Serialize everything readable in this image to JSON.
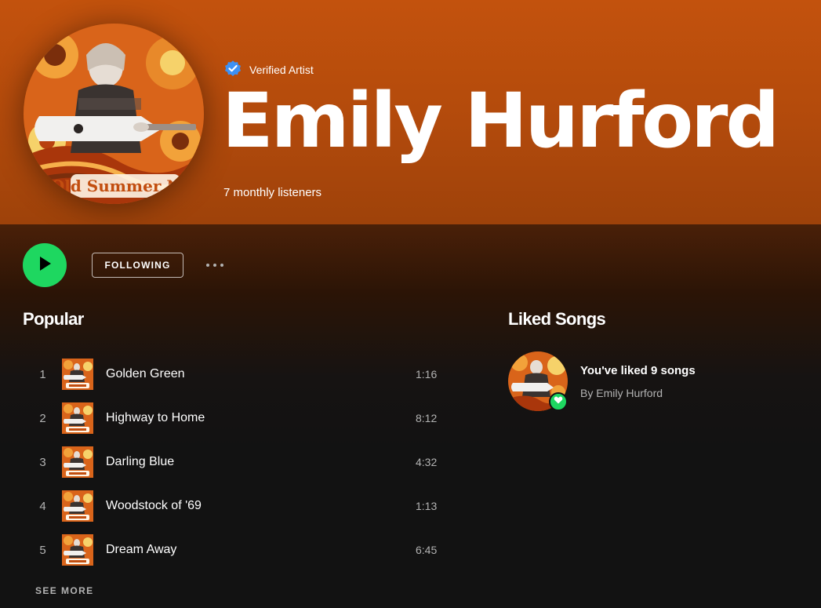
{
  "artist": {
    "verified_label": "Verified Artist",
    "name": "Emily Hurford",
    "monthly_listeners": "7 monthly listeners",
    "avatar_text": "Old Summer Nay"
  },
  "actions": {
    "follow_label": "FOLLOWING"
  },
  "popular": {
    "title": "Popular",
    "tracks": [
      {
        "num": "1",
        "title": "Golden Green",
        "duration": "1:16"
      },
      {
        "num": "2",
        "title": "Highway to Home",
        "duration": "8:12"
      },
      {
        "num": "3",
        "title": "Darling Blue",
        "duration": "4:32"
      },
      {
        "num": "4",
        "title": "Woodstock of '69",
        "duration": "1:13"
      },
      {
        "num": "5",
        "title": "Dream Away",
        "duration": "6:45"
      }
    ],
    "see_more_label": "SEE MORE"
  },
  "liked": {
    "title": "Liked Songs",
    "count_text": "You've liked 9 songs",
    "by_text": "By Emily Hurford"
  },
  "colors": {
    "accent_green": "#1ed760",
    "header_orange": "#c3520d",
    "verified_blue": "#3d91f4"
  },
  "icons": {
    "verified": "verified-badge-icon",
    "play": "play-icon",
    "more": "more-dots-icon",
    "heart": "heart-icon"
  }
}
